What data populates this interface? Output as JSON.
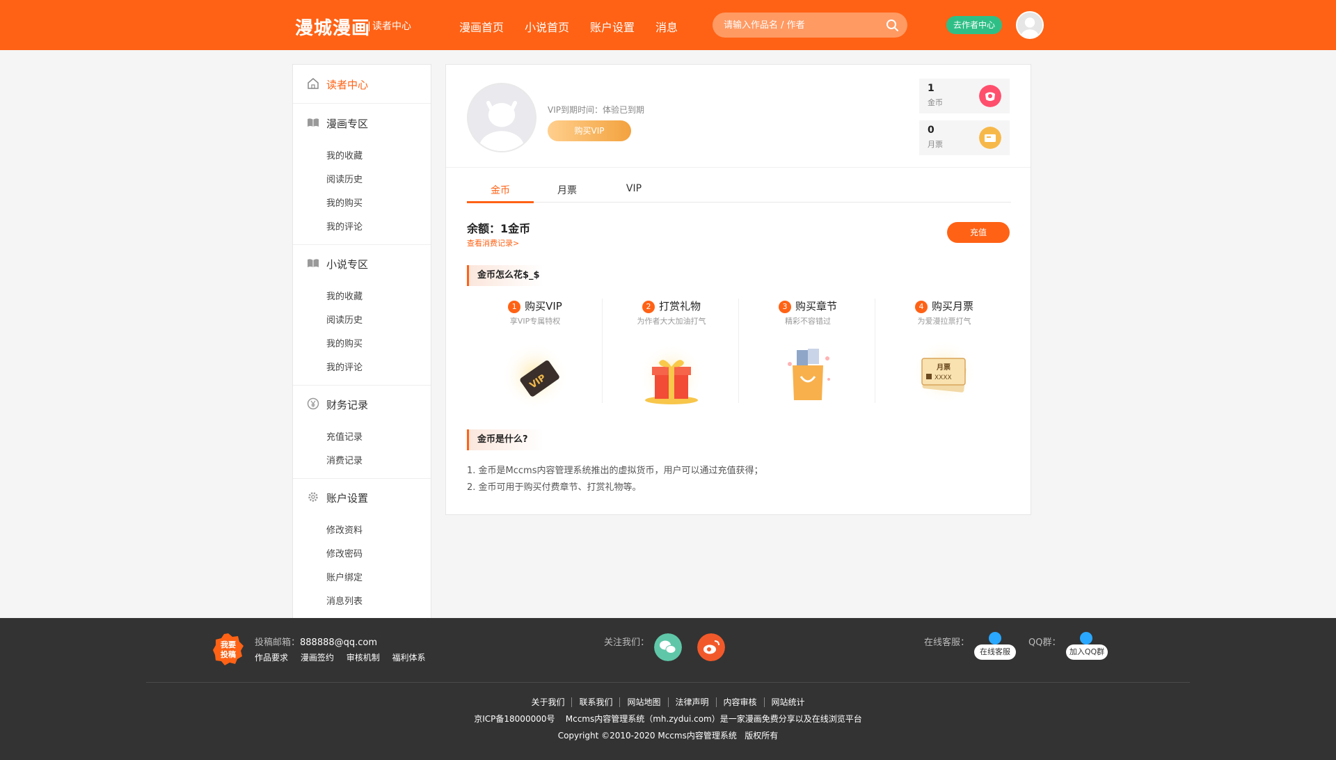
{
  "header": {
    "logo": "漫城漫画",
    "logo_sub": "读者中心",
    "nav": [
      "漫画首页",
      "小说首页",
      "账户设置",
      "消息"
    ],
    "search_placeholder": "请输入作品名 / 作者",
    "author_center": "去作者中心"
  },
  "sidebar": {
    "active": "读者中心",
    "comic": {
      "title": "漫画专区",
      "items": [
        "我的收藏",
        "阅读历史",
        "我的购买",
        "我的评论"
      ]
    },
    "novel": {
      "title": "小说专区",
      "items": [
        "我的收藏",
        "阅读历史",
        "我的购买",
        "我的评论"
      ]
    },
    "finance": {
      "title": "财务记录",
      "items": [
        "充值记录",
        "消费记录"
      ]
    },
    "account": {
      "title": "账户设置",
      "items": [
        "修改资料",
        "修改密码",
        "账户绑定",
        "消息列表"
      ]
    }
  },
  "profile": {
    "vip_expire": "VIP到期时间：体验已到期",
    "buy_vip": "购买VIP",
    "coins_value": "1",
    "coins_label": "金币",
    "tickets_value": "0",
    "tickets_label": "月票"
  },
  "tabs": [
    "金币",
    "月票",
    "VIP"
  ],
  "balance": {
    "text": "余额：1金币",
    "history_link": "查看消费记录>",
    "recharge": "充值"
  },
  "spend": {
    "title": "金币怎么花$_$",
    "ways": [
      {
        "num": "1",
        "title": "购买VIP",
        "sub": "享VIP专属特权",
        "icon": "vip-card-icon"
      },
      {
        "num": "2",
        "title": "打赏礼物",
        "sub": "为作者大大加油打气",
        "icon": "gift-icon"
      },
      {
        "num": "3",
        "title": "购买章节",
        "sub": "精彩不容错过",
        "icon": "shopping-bag-icon"
      },
      {
        "num": "4",
        "title": "购买月票",
        "sub": "为爱漫拉票打气",
        "icon": "ticket-icon"
      }
    ],
    "ticket_text": "月票",
    "ticket_code": "XXXX"
  },
  "about": {
    "title": "金币是什么?",
    "lines": [
      "1. 金币是Mccms内容管理系统推出的虚拟货币，用户可以通过充值获得；",
      "2. 金币可用于购买付费章节、打赏礼物等。"
    ]
  },
  "footer": {
    "badge": [
      "我要",
      "投稿"
    ],
    "email_label": "投稿邮箱：",
    "email": "888888@qq.com",
    "links": [
      "作品要求",
      "漫画签约",
      "审核机制",
      "福利体系"
    ],
    "follow": "关注我们：",
    "service_label": "在线客服：",
    "service_btn": "在线客服",
    "qq_label": "QQ群：",
    "qq_btn": "加入QQ群",
    "bottom_links": [
      "关于我们",
      "联系我们",
      "网站地图",
      "法律声明",
      "内容审核",
      "网站统计"
    ],
    "icp": "京ICP备18000000号    Mccms内容管理系统（mh.zydui.com）是一家漫画免费分享以及在线浏览平台",
    "copyright": "Copyright ©2010-2020 Mccms内容管理系统   版权所有"
  },
  "colors": {
    "brand": "#ff6215",
    "author_btn": "#2fbf86",
    "footer_bg": "#333333"
  }
}
